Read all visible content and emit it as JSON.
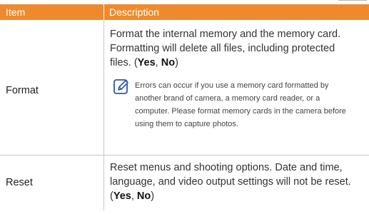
{
  "header": {
    "item": "Item",
    "description": "Description"
  },
  "rows": [
    {
      "item": "Format",
      "description_pre": "Format the internal memory and the memory card. Formatting will delete all files, including protected files. (",
      "yes": "Yes",
      "sep": ", ",
      "no": "No",
      "close": ")",
      "note_icon": "note-pencil-icon",
      "note": "Errors can occur if you use a memory card formatted by another brand of camera, a memory card reader, or a computer. Please format memory cards in the camera before using them to capture photos."
    },
    {
      "item": "Reset",
      "description_pre": "Reset menus and shooting options. Date and time, language, and video output settings will not be reset. (",
      "yes": "Yes",
      "sep": ", ",
      "no": "No",
      "close": ")"
    }
  ],
  "colors": {
    "header_bg": "#ef8a2c",
    "header_text": "#ffffff",
    "divider": "#c9c9c9"
  }
}
